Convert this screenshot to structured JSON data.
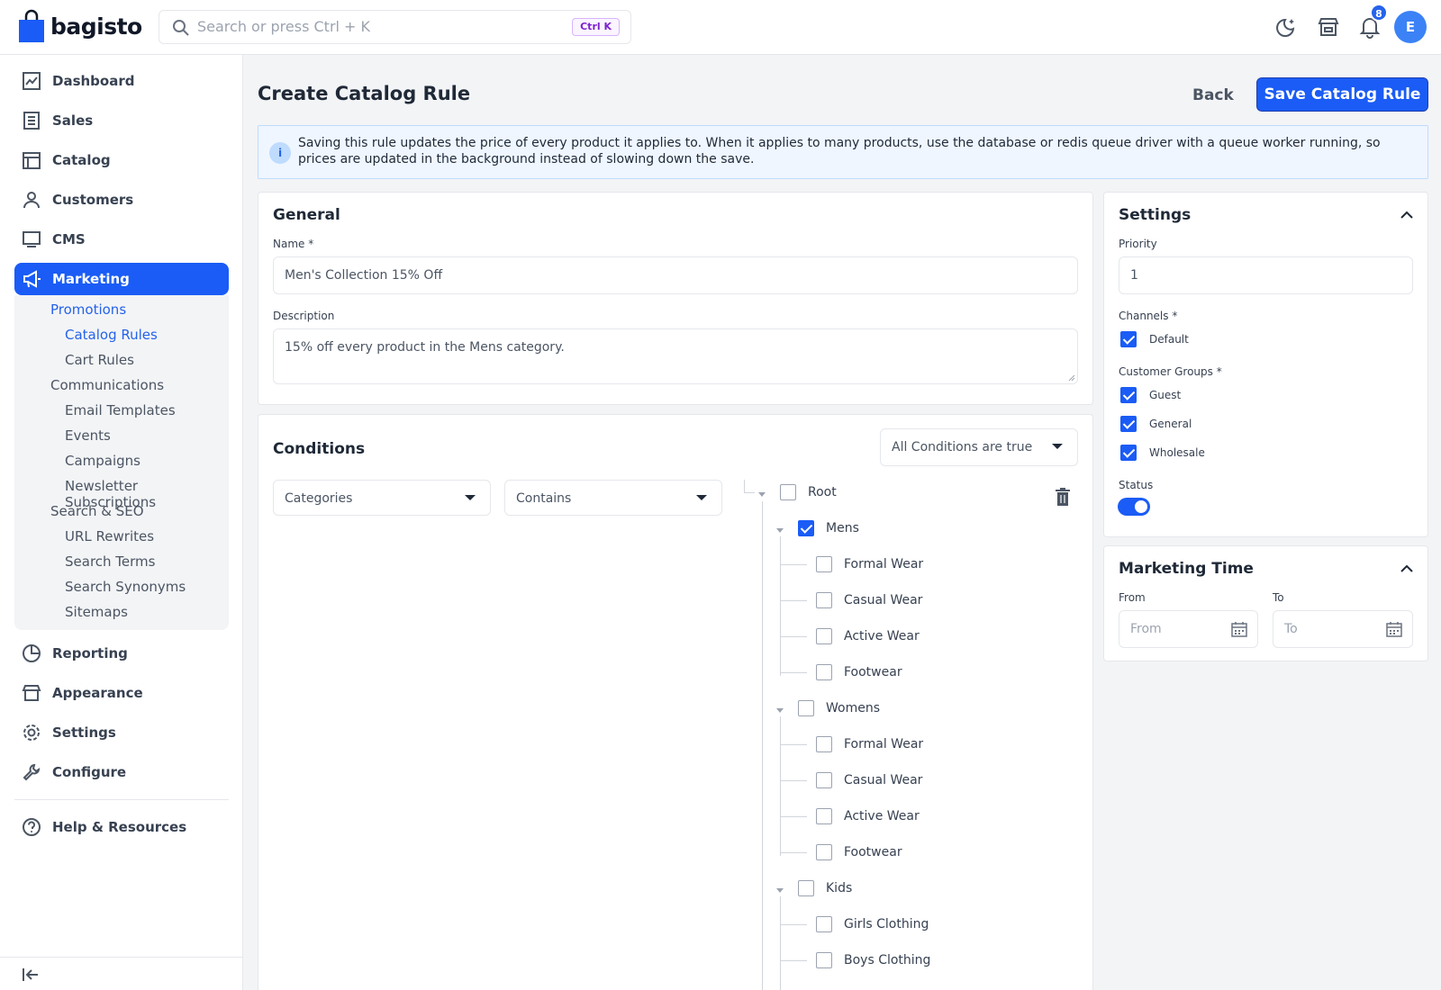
{
  "header": {
    "brand": "bagisto",
    "search_placeholder": "Search or press Ctrl + K",
    "search_shortcut": "Ctrl K",
    "notification_count": "8",
    "avatar_initial": "E"
  },
  "sidebar": {
    "items": [
      {
        "label": "Dashboard"
      },
      {
        "label": "Sales"
      },
      {
        "label": "Catalog"
      },
      {
        "label": "Customers"
      },
      {
        "label": "CMS"
      },
      {
        "label": "Marketing"
      },
      {
        "label": "Reporting"
      },
      {
        "label": "Appearance"
      },
      {
        "label": "Settings"
      },
      {
        "label": "Configure"
      },
      {
        "label": "Help & Resources"
      }
    ],
    "marketing_sub": {
      "promotions": "Promotions",
      "catalog_rules": "Catalog Rules",
      "cart_rules": "Cart Rules",
      "communications": "Communications",
      "email_templates": "Email Templates",
      "events": "Events",
      "campaigns": "Campaigns",
      "newsletter": "Newsletter Subscriptions",
      "search_seo": "Search & SEO",
      "url_rewrites": "URL Rewrites",
      "search_terms": "Search Terms",
      "search_synonyms": "Search Synonyms",
      "sitemaps": "Sitemaps"
    }
  },
  "page": {
    "title": "Create Catalog Rule",
    "back_label": "Back",
    "save_label": "Save Catalog Rule",
    "info_text": "Saving this rule updates the price of every product it applies to. When it applies to many products, use the database or redis queue driver with a queue worker running, so prices are updated in the background instead of slowing down the save."
  },
  "general": {
    "title": "General",
    "name_label": "Name *",
    "name_value": "Men's Collection 15% Off",
    "description_label": "Description",
    "description_value": "15% off every product in the Mens category."
  },
  "conditions": {
    "title": "Conditions",
    "match_select": "All Conditions are true",
    "attribute_select": "Categories",
    "operator_select": "Contains",
    "tree": {
      "root": "Root",
      "groups": [
        {
          "label": "Mens",
          "checked": true,
          "children": [
            "Formal Wear",
            "Casual Wear",
            "Active Wear",
            "Footwear"
          ]
        },
        {
          "label": "Womens",
          "checked": false,
          "children": [
            "Formal Wear",
            "Casual Wear",
            "Active Wear",
            "Footwear"
          ]
        },
        {
          "label": "Kids",
          "checked": false,
          "children": [
            "Girls Clothing",
            "Boys Clothing"
          ]
        }
      ]
    }
  },
  "settings": {
    "title": "Settings",
    "priority_label": "Priority",
    "priority_value": "1",
    "channels_label": "Channels *",
    "channels": [
      {
        "label": "Default",
        "checked": true
      }
    ],
    "customer_groups_label": "Customer Groups *",
    "customer_groups": [
      {
        "label": "Guest",
        "checked": true
      },
      {
        "label": "General",
        "checked": true
      },
      {
        "label": "Wholesale",
        "checked": true
      }
    ],
    "status_label": "Status",
    "status_on": true
  },
  "marketing_time": {
    "title": "Marketing Time",
    "from_label": "From",
    "from_placeholder": "From",
    "to_label": "To",
    "to_placeholder": "To"
  },
  "colors": {
    "primary": "#1a5cf5",
    "info_bg": "#eff6ff"
  }
}
